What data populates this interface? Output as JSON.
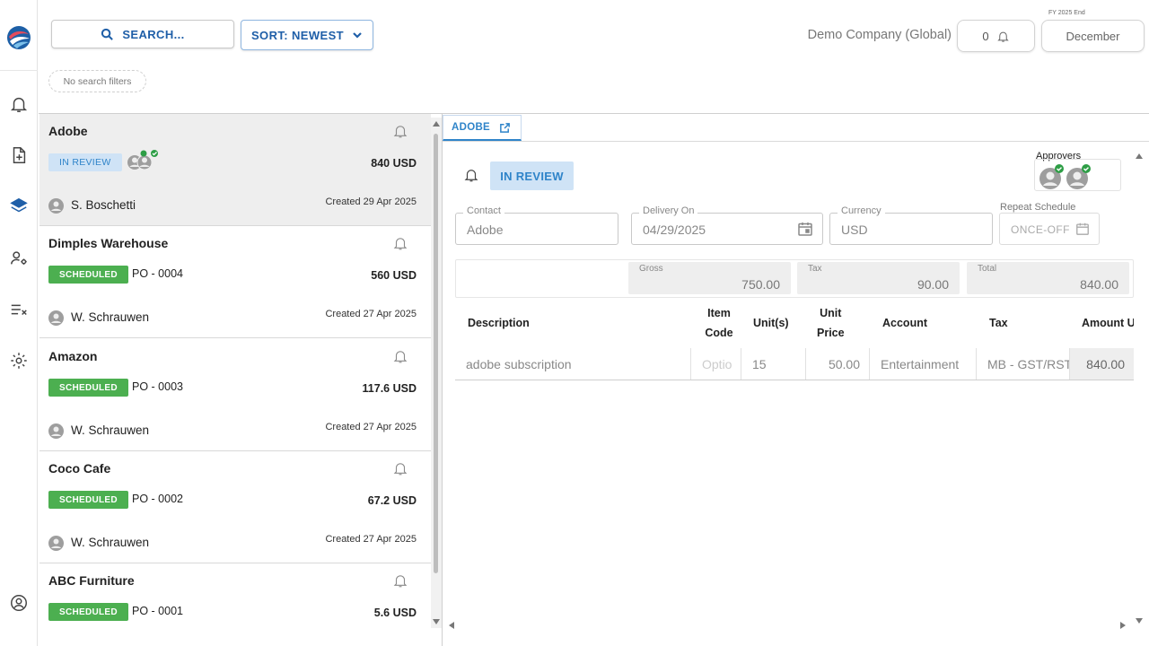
{
  "toolbar": {
    "search_label": "SEARCH...",
    "sort_label": "SORT: NEWEST",
    "filters_label": "No search filters",
    "company": "Demo Company (Global)",
    "notifications_count": "0",
    "fy_label": "FY 2025 End",
    "month": "December"
  },
  "rail": {
    "icons": [
      "logo-icon",
      "bell-icon",
      "add-document-icon",
      "layers-icon",
      "user-settings-icon",
      "checklist-icon",
      "gear-icon",
      "account-icon"
    ]
  },
  "orders": [
    {
      "name": "Adobe",
      "status": "IN REVIEW",
      "po": "",
      "amount": "840 USD",
      "user": "S. Boschetti",
      "created": "Created 29 Apr 2025"
    },
    {
      "name": "Dimples Warehouse",
      "status": "SCHEDULED",
      "po": "PO - 0004",
      "amount": "560 USD",
      "user": "W. Schrauwen",
      "created": "Created 27 Apr 2025"
    },
    {
      "name": "Amazon",
      "status": "SCHEDULED",
      "po": "PO - 0003",
      "amount": "117.6 USD",
      "user": "W. Schrauwen",
      "created": "Created 27 Apr 2025"
    },
    {
      "name": "Coco Cafe",
      "status": "SCHEDULED",
      "po": "PO - 0002",
      "amount": "67.2 USD",
      "user": "W. Schrauwen",
      "created": "Created 27 Apr 2025"
    },
    {
      "name": "ABC Furniture",
      "status": "SCHEDULED",
      "po": "PO - 0001",
      "amount": "5.6 USD",
      "user": "",
      "created": ""
    }
  ],
  "detail": {
    "tab_label": "ADOBE",
    "status": "IN REVIEW",
    "approvers_label": "Approvers",
    "contact": {
      "label": "Contact",
      "value": "Adobe"
    },
    "delivery": {
      "label": "Delivery On",
      "value": "04/29/2025"
    },
    "currency": {
      "label": "Currency",
      "value": "USD"
    },
    "repeat": {
      "label": "Repeat Schedule",
      "value": "ONCE-OFF"
    },
    "totals": {
      "gross_label": "Gross",
      "gross": "750.00",
      "tax_label": "Tax",
      "tax": "90.00",
      "total_label": "Total",
      "total": "840.00"
    },
    "columns": {
      "description": "Description",
      "item_code_1": "Item",
      "item_code_2": "Code",
      "units": "Unit(s)",
      "unit_price_1": "Unit",
      "unit_price_2": "Price",
      "account": "Account",
      "tax": "Tax",
      "amount": "Amount U"
    },
    "line": {
      "description": "adobe subscription",
      "item_code_placeholder": "Optio",
      "units": "15",
      "unit_price": "50.00",
      "account": "Entertainment",
      "tax": "MB - GST/RST",
      "amount": "840.00"
    }
  },
  "colors": {
    "accent": "#2f84c9",
    "scheduled": "#4caf50",
    "review_bg": "#cfe3f6"
  }
}
